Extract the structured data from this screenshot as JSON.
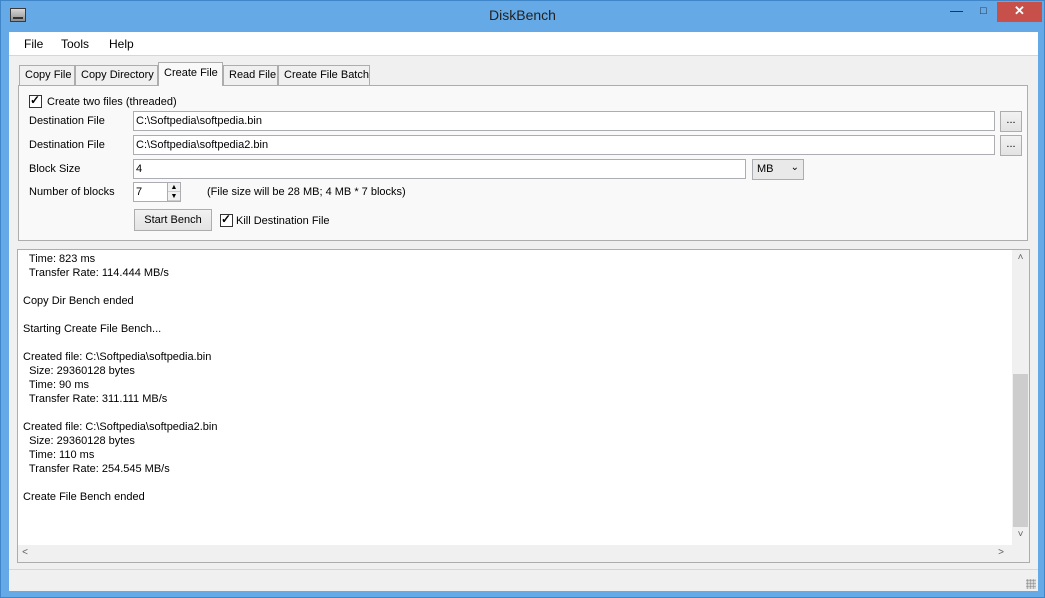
{
  "window": {
    "title": "DiskBench",
    "minimize": "—",
    "maximize": "□",
    "close": "✕"
  },
  "menu": [
    "File",
    "Tools",
    "Help"
  ],
  "tabs": [
    "Copy File",
    "Copy Directory",
    "Create File",
    "Read File",
    "Create File Batch"
  ],
  "active_tab": "Create File",
  "form": {
    "create_two_files_label": "Create two files (threaded)",
    "create_two_files_checked": true,
    "dest1_label": "Destination File",
    "dest1_value": "C:\\Softpedia\\softpedia.bin",
    "dest2_label": "Destination File",
    "dest2_value": "C:\\Softpedia\\softpedia2.bin",
    "browse_label": "...",
    "block_size_label": "Block Size",
    "block_size_value": "4",
    "unit_value": "MB",
    "num_blocks_label": "Number of blocks",
    "num_blocks_value": "7",
    "file_size_note": "(File size will be 28 MB; 4 MB * 7 blocks)",
    "start_button": "Start Bench",
    "kill_dest_label": "Kill Destination File",
    "kill_dest_checked": true
  },
  "log": {
    "lines": [
      "  Time: 823 ms",
      "  Transfer Rate: 114.444 MB/s",
      "",
      "Copy Dir Bench ended",
      "",
      "Starting Create File Bench...",
      "",
      "Created file: C:\\Softpedia\\softpedia.bin",
      "  Size: 29360128 bytes",
      "  Time: 90 ms",
      "  Transfer Rate: 311.111 MB/s",
      "",
      "Created file: C:\\Softpedia\\softpedia2.bin",
      "  Size: 29360128 bytes",
      "  Time: 110 ms",
      "  Transfer Rate: 254.545 MB/s",
      "",
      "Create File Bench ended"
    ]
  }
}
